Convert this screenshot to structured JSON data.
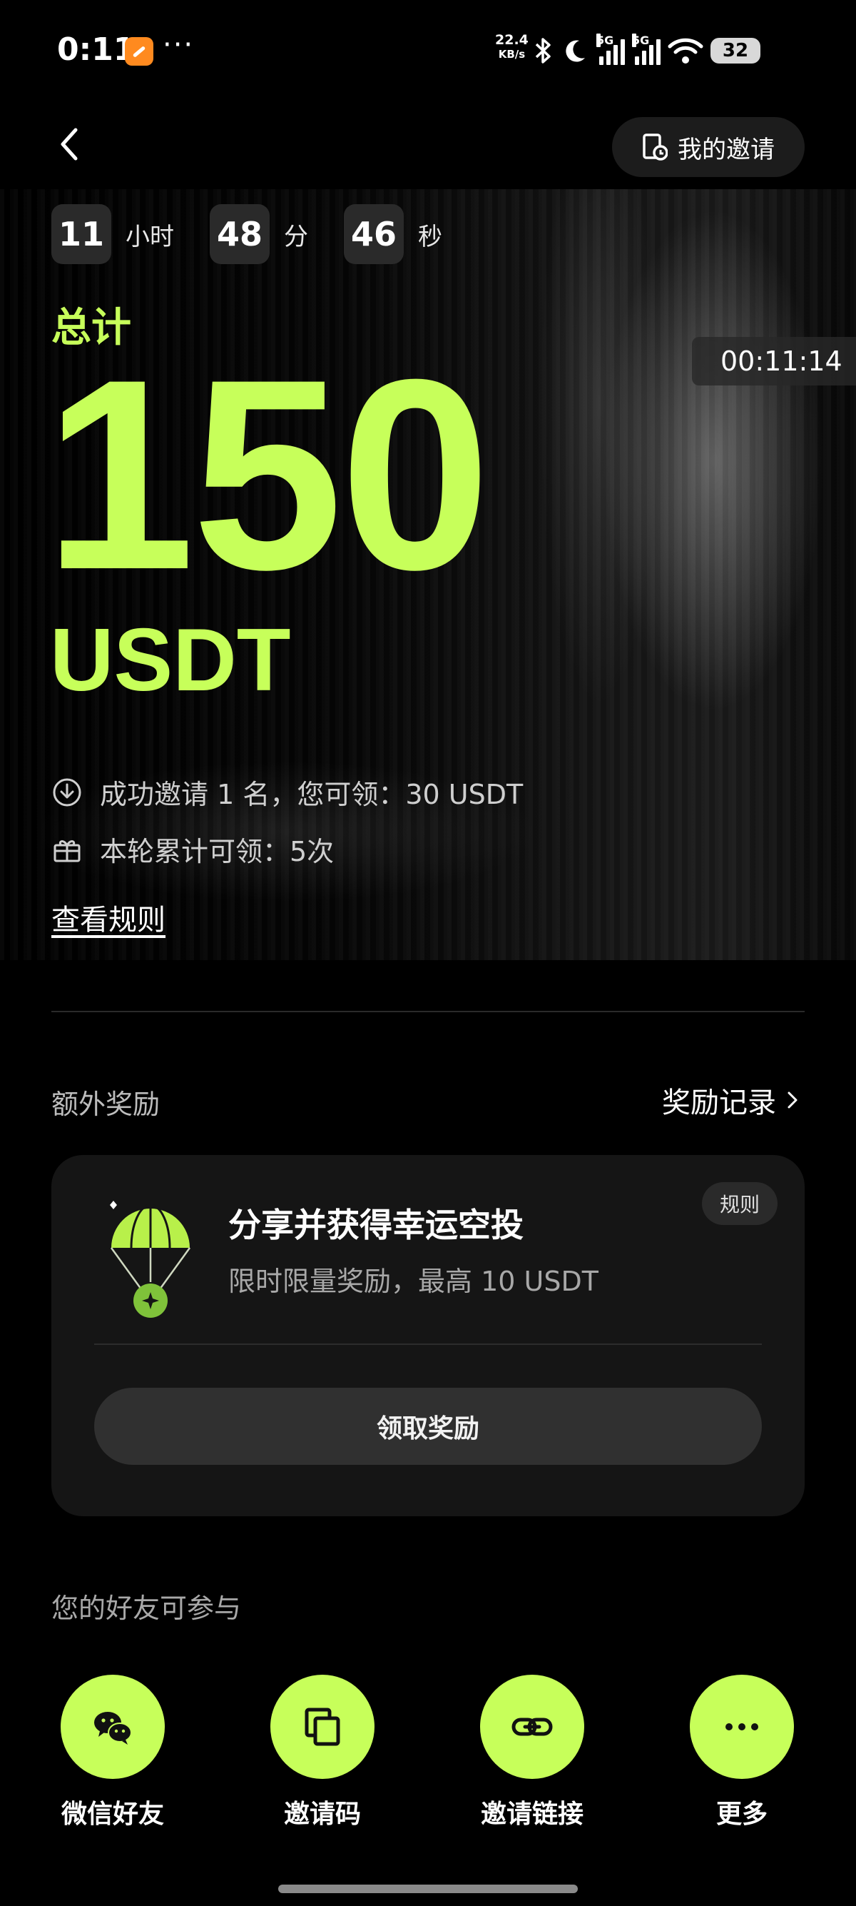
{
  "status_bar": {
    "time": "0:11",
    "dots": "···",
    "net_speed_value": "22.4",
    "net_speed_unit": "KB/s",
    "sim1_label": "5G",
    "sim2_label": "5G",
    "battery": "32"
  },
  "header": {
    "my_invites_label": "我的邀请"
  },
  "countdown": {
    "hours": "11",
    "hours_unit": "小时",
    "minutes": "48",
    "minutes_unit": "分",
    "seconds": "46",
    "seconds_unit": "秒"
  },
  "clock_badge": "00:11:14",
  "total": {
    "label": "总计",
    "amount": "150",
    "unit": "USDT"
  },
  "info": {
    "invite_line": "成功邀请 1 名，您可领：30 USDT",
    "claims_line": "本轮累计可领：5次",
    "rules_link": "查看规则"
  },
  "extra": {
    "section_title": "额外奖励",
    "record_link": "奖励记录"
  },
  "card": {
    "title": "分享并获得幸运空投",
    "subtitle": "限时限量奖励，最高 10 USDT",
    "rules_label": "规则",
    "claim_label": "领取奖励"
  },
  "friends": {
    "title": "您的好友可参与",
    "items": [
      {
        "label": "微信好友",
        "icon": "wechat-icon"
      },
      {
        "label": "邀请码",
        "icon": "copy-icon"
      },
      {
        "label": "邀请链接",
        "icon": "link-icon"
      },
      {
        "label": "更多",
        "icon": "more-icon"
      }
    ]
  },
  "colors": {
    "accent": "#c7ff5a",
    "background": "#000000",
    "card": "#151515"
  }
}
